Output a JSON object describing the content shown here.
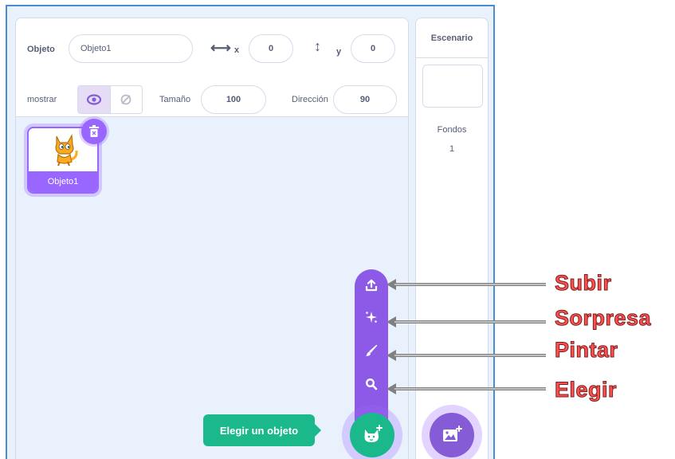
{
  "sprite_info": {
    "sprite_label": "Objeto",
    "sprite_name": "Objeto1",
    "x_label": "x",
    "x_value": "0",
    "y_label": "y",
    "y_value": "0",
    "show_label": "mostrar",
    "size_label": "Tamaño",
    "size_value": "100",
    "direction_label": "Dirección",
    "direction_value": "90"
  },
  "sprites": [
    {
      "name": "Objeto1",
      "selected": true
    }
  ],
  "stage": {
    "header": "Escenario",
    "backdrops_label": "Fondos",
    "backdrops_count": "1"
  },
  "sprite_menu": {
    "tooltip": "Elegir un objeto",
    "items": [
      {
        "icon": "upload-icon",
        "annotation": "Subir"
      },
      {
        "icon": "surprise-sparkle-icon",
        "annotation": "Sorpresa"
      },
      {
        "icon": "paint-brush-icon",
        "annotation": "Pintar"
      },
      {
        "icon": "search-icon",
        "annotation": "Elegir"
      }
    ]
  },
  "colors": {
    "accent": "#9966ff",
    "menu": "#8c5ae6",
    "choose_button": "#1ab88a",
    "annotation_text": "#ff4f4f",
    "pane_background": "#e9f1fc"
  }
}
